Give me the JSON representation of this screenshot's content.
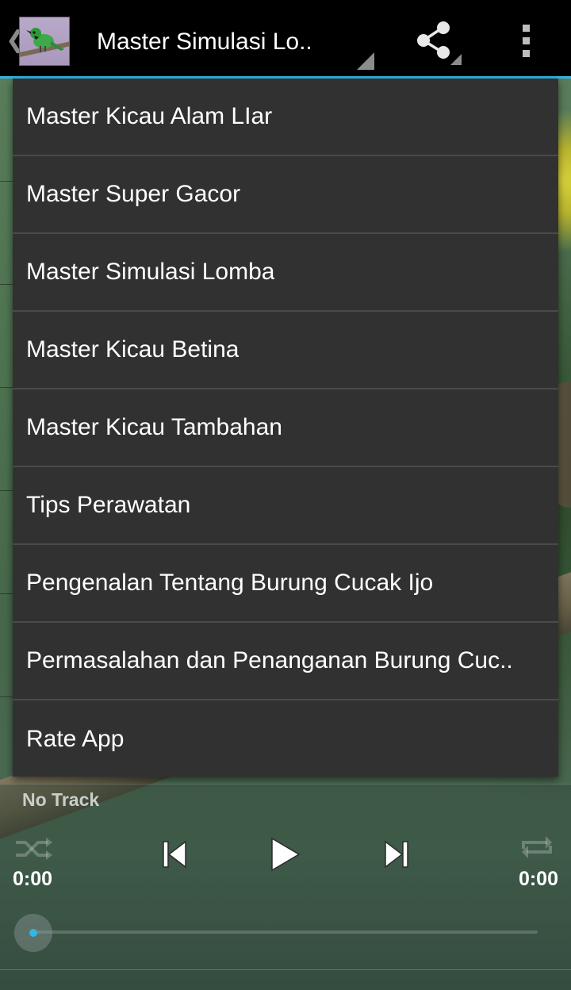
{
  "action_bar": {
    "title": "Master Simulasi Lo..",
    "up_icon": "chevron-left-icon",
    "app_icon": "bird-app-icon",
    "share_icon": "share-icon",
    "overflow_icon": "overflow-menu-icon"
  },
  "menu": {
    "items": [
      {
        "label": "Master Kicau Alam LIar"
      },
      {
        "label": "Master Super Gacor"
      },
      {
        "label": "Master Simulasi Lomba"
      },
      {
        "label": "Master Kicau Betina"
      },
      {
        "label": "Master Kicau Tambahan"
      },
      {
        "label": "Tips Perawatan"
      },
      {
        "label": "Pengenalan Tentang Burung Cucak Ijo"
      },
      {
        "label": "Permasalahan dan Penanganan Burung Cuc.."
      },
      {
        "label": "Rate App"
      }
    ]
  },
  "player": {
    "track_title": "No Track",
    "time_elapsed": "0:00",
    "time_total": "0:00",
    "progress": 0,
    "controls": [
      "shuffle-icon",
      "previous-icon",
      "play-icon",
      "next-icon",
      "repeat-icon"
    ]
  },
  "colors": {
    "accent": "#33b5e5",
    "menu_background": "#313131",
    "menu_divider": "#4a4a4a",
    "action_bar": "#000000"
  }
}
